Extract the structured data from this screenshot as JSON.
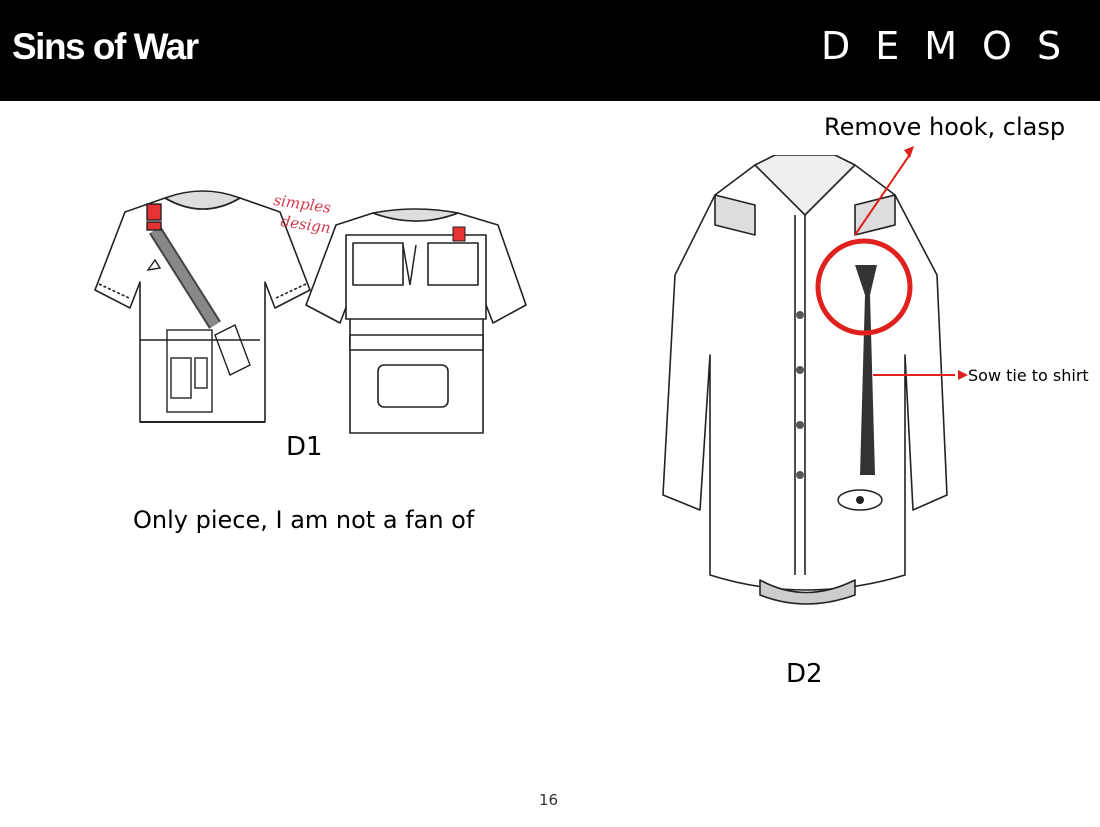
{
  "header": {
    "title": "Sins of War",
    "brand": "DEMOS"
  },
  "designs": [
    {
      "label": "D1",
      "note": "Only piece, I am not a fan of",
      "handwritten": [
        "simples",
        "design"
      ]
    },
    {
      "label": "D2"
    }
  ],
  "annotations": {
    "remove": "Remove hook, clasp",
    "sew": "Sow tie to shirt"
  },
  "page_number": "16",
  "colors": {
    "header_bg": "#000000",
    "annotation_red": "#e0201c",
    "handwriting": "#d43a4e"
  }
}
